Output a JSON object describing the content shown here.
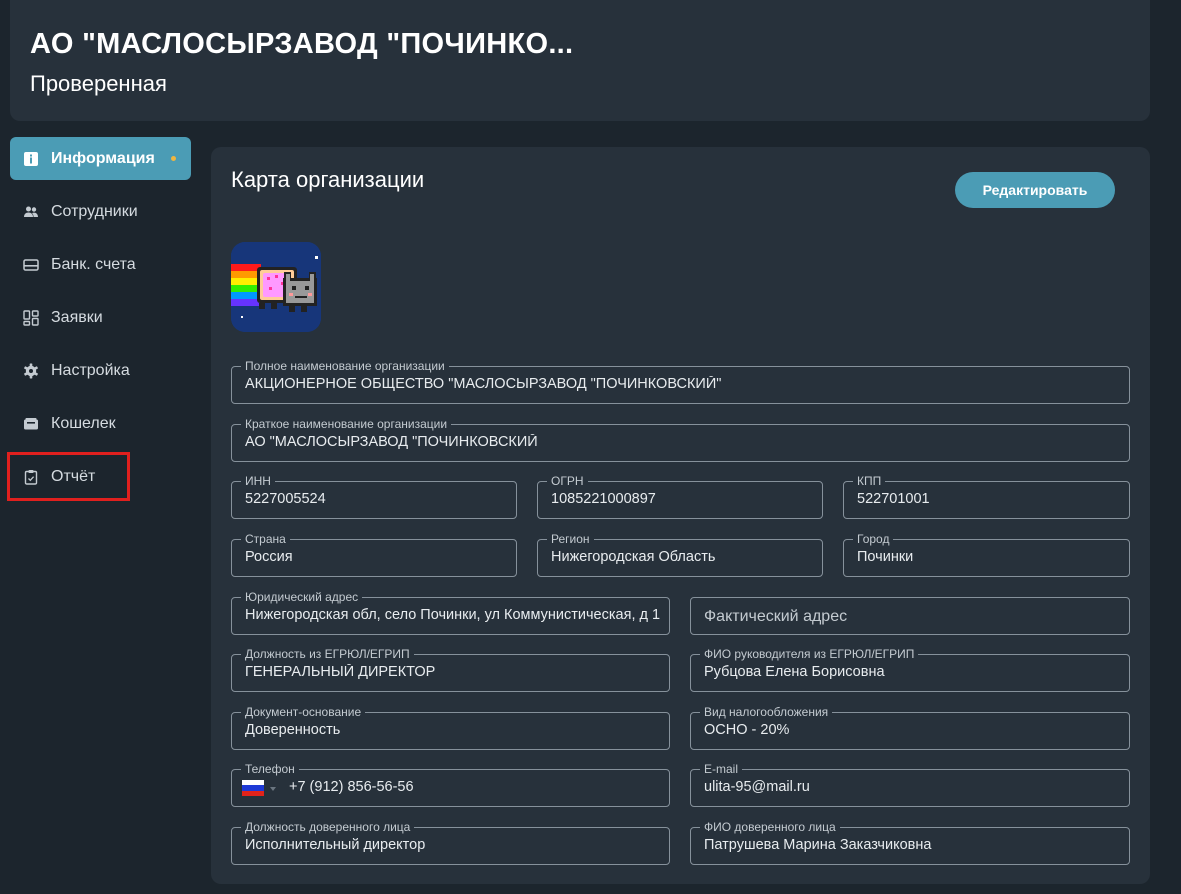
{
  "header": {
    "title": "АО \"МАСЛОСЫРЗАВОД \"ПОЧИНКО...",
    "subtitle": "Проверенная"
  },
  "sidebar": {
    "items": [
      {
        "label": "Информация",
        "icon": "info-icon",
        "active": true
      },
      {
        "label": "Сотрудники",
        "icon": "people-icon"
      },
      {
        "label": "Банк. счета",
        "icon": "bank-card-icon"
      },
      {
        "label": "Заявки",
        "icon": "grid-icon"
      },
      {
        "label": "Настройка",
        "icon": "gear-icon"
      },
      {
        "label": "Кошелек",
        "icon": "wallet-icon"
      },
      {
        "label": "Отчёт",
        "icon": "clipboard-icon"
      }
    ]
  },
  "card": {
    "title": "Карта организации",
    "edit_label": "Редактировать"
  },
  "fields": {
    "full_name": {
      "label": "Полное наименование организации",
      "value": "АКЦИОНЕРНОЕ ОБЩЕСТВО \"МАСЛОСЫРЗАВОД \"ПОЧИНКОВСКИЙ\""
    },
    "short_name": {
      "label": "Краткое наименование организации",
      "value": "АО \"МАСЛОСЫРЗАВОД \"ПОЧИНКОВСКИЙ"
    },
    "inn": {
      "label": "ИНН",
      "value": "5227005524"
    },
    "ogrn": {
      "label": "ОГРН",
      "value": "1085221000897"
    },
    "kpp": {
      "label": "КПП",
      "value": "522701001"
    },
    "country": {
      "label": "Страна",
      "value": "Россия"
    },
    "region": {
      "label": "Регион",
      "value": "Нижегородская Область"
    },
    "city": {
      "label": "Город",
      "value": "Починки"
    },
    "legal_address": {
      "label": "Юридический адрес",
      "value": "Нижегородская обл, село Починки, ул Коммунистическая, д 1"
    },
    "actual_address": {
      "placeholder": "Фактический адрес"
    },
    "position": {
      "label": "Должность из ЕГРЮЛ/ЕГРИП",
      "value": "ГЕНЕРАЛЬНЫЙ ДИРЕКТОР"
    },
    "director": {
      "label": "ФИО руководителя из ЕГРЮЛ/ЕГРИП",
      "value": "Рубцова Елена Борисовна"
    },
    "basis_doc": {
      "label": "Документ-основание",
      "value": "Доверенность"
    },
    "tax_system": {
      "label": "Вид налогообложения",
      "value": "ОСНО - 20%"
    },
    "phone": {
      "label": "Телефон",
      "value": "+7 (912) 856-56-56"
    },
    "email": {
      "label": "E-mail",
      "value": "ulita-95@mail.ru"
    },
    "proxy_position": {
      "label": "Должность доверенного лица",
      "value": "Исполнительный директор"
    },
    "proxy_name": {
      "label": "ФИО доверенного лица",
      "value": "Патрушева Марина Заказчиковна"
    }
  },
  "colors": {
    "accent": "#4b9cb5",
    "highlight": "#e0201e",
    "dot": "#f0b640"
  }
}
